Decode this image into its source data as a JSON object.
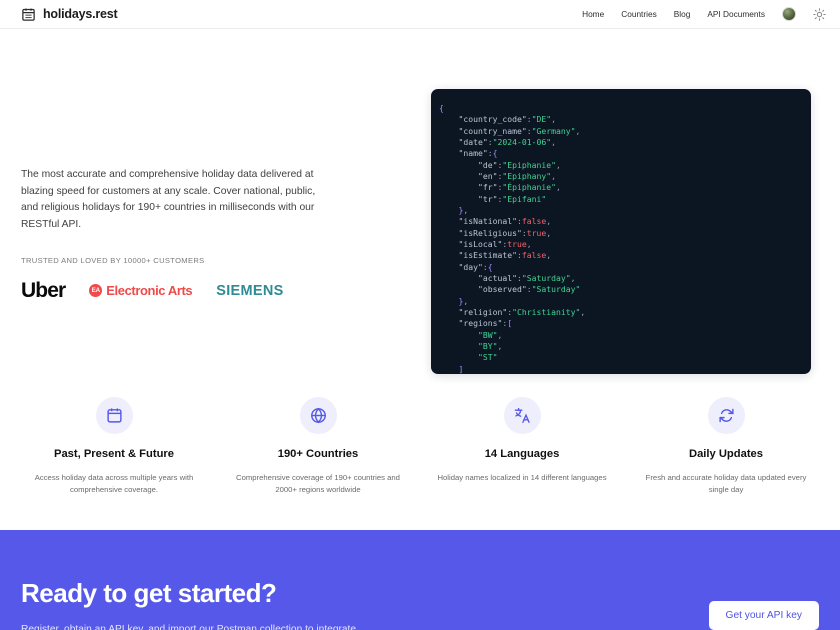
{
  "header": {
    "logo_icon": "calendar-icon",
    "brand_name": "holidays.rest",
    "nav": [
      {
        "label": "Home"
      },
      {
        "label": "Countries"
      },
      {
        "label": "Blog"
      },
      {
        "label": "API Documents"
      }
    ],
    "avatar_alt": "user-avatar",
    "theme_toggle_icon": "sun-icon"
  },
  "hero": {
    "description": "The most accurate and comprehensive holiday data delivered at blazing speed for customers at any scale. Cover national, public, and religious holidays for 190+ countries in milliseconds with our RESTful API.",
    "trusted_label": "TRUSTED AND LOVED BY 10000+ CUSTOMERS",
    "logos": [
      {
        "name": "Uber"
      },
      {
        "name": "Electronic Arts",
        "badge": "EA"
      },
      {
        "name": "SIEMENS"
      }
    ],
    "code_sample": {
      "language": "json",
      "lines": [
        {
          "indent": 0,
          "parts": [
            {
              "t": "punct",
              "v": "{"
            }
          ]
        },
        {
          "indent": 1,
          "parts": [
            {
              "t": "key",
              "v": "\"country_code\""
            },
            {
              "t": "col",
              "v": ":"
            },
            {
              "t": "str",
              "v": "\"DE\""
            },
            {
              "t": "col",
              "v": ","
            }
          ]
        },
        {
          "indent": 1,
          "parts": [
            {
              "t": "key",
              "v": "\"country_name\""
            },
            {
              "t": "col",
              "v": ":"
            },
            {
              "t": "str",
              "v": "\"Germany\""
            },
            {
              "t": "col",
              "v": ","
            }
          ]
        },
        {
          "indent": 1,
          "parts": [
            {
              "t": "key",
              "v": "\"date\""
            },
            {
              "t": "col",
              "v": ":"
            },
            {
              "t": "str",
              "v": "\"2024-01-06\""
            },
            {
              "t": "col",
              "v": ","
            }
          ]
        },
        {
          "indent": 1,
          "parts": [
            {
              "t": "key",
              "v": "\"name\""
            },
            {
              "t": "col",
              "v": ":"
            },
            {
              "t": "punct",
              "v": "{"
            }
          ]
        },
        {
          "indent": 2,
          "parts": [
            {
              "t": "key",
              "v": "\"de\""
            },
            {
              "t": "col",
              "v": ":"
            },
            {
              "t": "str",
              "v": "\"Epiphanie\""
            },
            {
              "t": "col",
              "v": ","
            }
          ]
        },
        {
          "indent": 2,
          "parts": [
            {
              "t": "key",
              "v": "\"en\""
            },
            {
              "t": "col",
              "v": ":"
            },
            {
              "t": "str",
              "v": "\"Epiphany\""
            },
            {
              "t": "col",
              "v": ","
            }
          ]
        },
        {
          "indent": 2,
          "parts": [
            {
              "t": "key",
              "v": "\"fr\""
            },
            {
              "t": "col",
              "v": ":"
            },
            {
              "t": "str",
              "v": "\"Épiphanie\""
            },
            {
              "t": "col",
              "v": ","
            }
          ]
        },
        {
          "indent": 2,
          "parts": [
            {
              "t": "key",
              "v": "\"tr\""
            },
            {
              "t": "col",
              "v": ":"
            },
            {
              "t": "str",
              "v": "\"Epifani\""
            }
          ]
        },
        {
          "indent": 1,
          "parts": [
            {
              "t": "punct",
              "v": "}"
            },
            {
              "t": "col",
              "v": ","
            }
          ]
        },
        {
          "indent": 1,
          "parts": [
            {
              "t": "key",
              "v": "\"isNational\""
            },
            {
              "t": "col",
              "v": ":"
            },
            {
              "t": "bool",
              "v": "false"
            },
            {
              "t": "col",
              "v": ","
            }
          ]
        },
        {
          "indent": 1,
          "parts": [
            {
              "t": "key",
              "v": "\"isReligious\""
            },
            {
              "t": "col",
              "v": ":"
            },
            {
              "t": "bool",
              "v": "true"
            },
            {
              "t": "col",
              "v": ","
            }
          ]
        },
        {
          "indent": 1,
          "parts": [
            {
              "t": "key",
              "v": "\"isLocal\""
            },
            {
              "t": "col",
              "v": ":"
            },
            {
              "t": "bool",
              "v": "true"
            },
            {
              "t": "col",
              "v": ","
            }
          ]
        },
        {
          "indent": 1,
          "parts": [
            {
              "t": "key",
              "v": "\"isEstimate\""
            },
            {
              "t": "col",
              "v": ":"
            },
            {
              "t": "bool",
              "v": "false"
            },
            {
              "t": "col",
              "v": ","
            }
          ]
        },
        {
          "indent": 1,
          "parts": [
            {
              "t": "key",
              "v": "\"day\""
            },
            {
              "t": "col",
              "v": ":"
            },
            {
              "t": "punct",
              "v": "{"
            }
          ]
        },
        {
          "indent": 2,
          "parts": [
            {
              "t": "key",
              "v": "\"actual\""
            },
            {
              "t": "col",
              "v": ":"
            },
            {
              "t": "str",
              "v": "\"Saturday\""
            },
            {
              "t": "col",
              "v": ","
            }
          ]
        },
        {
          "indent": 2,
          "parts": [
            {
              "t": "key",
              "v": "\"observed\""
            },
            {
              "t": "col",
              "v": ":"
            },
            {
              "t": "str",
              "v": "\"Saturday\""
            }
          ]
        },
        {
          "indent": 1,
          "parts": [
            {
              "t": "punct",
              "v": "}"
            },
            {
              "t": "col",
              "v": ","
            }
          ]
        },
        {
          "indent": 1,
          "parts": [
            {
              "t": "key",
              "v": "\"religion\""
            },
            {
              "t": "col",
              "v": ":"
            },
            {
              "t": "str",
              "v": "\"Christianity\""
            },
            {
              "t": "col",
              "v": ","
            }
          ]
        },
        {
          "indent": 1,
          "parts": [
            {
              "t": "key",
              "v": "\"regions\""
            },
            {
              "t": "col",
              "v": ":"
            },
            {
              "t": "punct",
              "v": "["
            }
          ]
        },
        {
          "indent": 2,
          "parts": [
            {
              "t": "str",
              "v": "\"BW\""
            },
            {
              "t": "col",
              "v": ","
            }
          ]
        },
        {
          "indent": 2,
          "parts": [
            {
              "t": "str",
              "v": "\"BY\""
            },
            {
              "t": "col",
              "v": ","
            }
          ]
        },
        {
          "indent": 2,
          "parts": [
            {
              "t": "str",
              "v": "\"ST\""
            }
          ]
        },
        {
          "indent": 1,
          "parts": [
            {
              "t": "punct",
              "v": "]"
            }
          ]
        },
        {
          "indent": 0,
          "parts": [
            {
              "t": "punct",
              "v": "}"
            }
          ]
        }
      ]
    }
  },
  "features": [
    {
      "icon": "calendar-icon",
      "title": "Past, Present & Future",
      "description": "Access holiday data across multiple years with comprehensive coverage."
    },
    {
      "icon": "globe-icon",
      "title": "190+ Countries",
      "description": "Comprehensive coverage of 190+ countries and 2000+ regions worldwide"
    },
    {
      "icon": "translate-icon",
      "title": "14 Languages",
      "description": "Holiday names localized in 14 different languages"
    },
    {
      "icon": "sync-icon",
      "title": "Daily Updates",
      "description": "Fresh and accurate holiday data updated every single day"
    }
  ],
  "cta": {
    "title": "Ready to get started?",
    "subtitle": "Register, obtain an API key, and import our Postman collection to integrate",
    "button_label": "Get your API key"
  },
  "colors": {
    "accent": "#5558e8",
    "code_background": "#0c1622",
    "icon_badge": "#eeeefc",
    "string_token": "#41d392",
    "bool_token": "#f1616b",
    "punct_token": "#a78bfa"
  }
}
